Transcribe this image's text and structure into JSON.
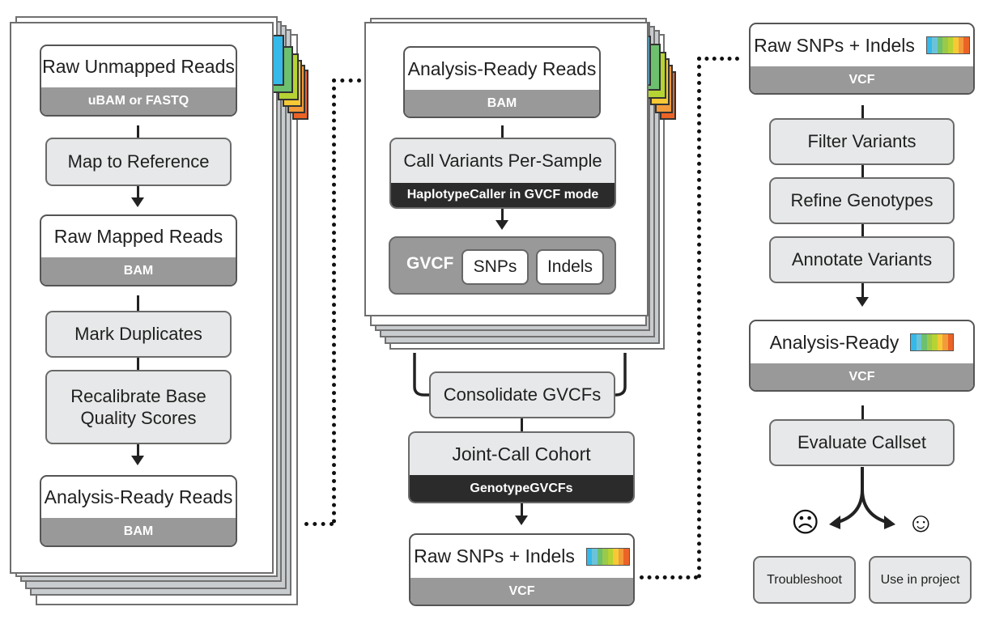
{
  "colors": {
    "tab_blue": "#35b9ea",
    "tab_green": "#6cc06e",
    "tab_lime": "#b6d334",
    "tab_yellow": "#f7c935",
    "tab_orange": "#f39a3b",
    "tab_red": "#ec6326",
    "format_bar": "#999999",
    "tool_bar": "#2b2b2b",
    "step_fill": "#e7e8e9"
  },
  "rainbow": [
    "#35b9ea",
    "#6cc3d8",
    "#6cc06e",
    "#9bc94a",
    "#b6d334",
    "#f7c935",
    "#f39a3b",
    "#ec6326"
  ],
  "panel1": {
    "tab_number": "1",
    "raw_unmapped": {
      "title": "Raw Unmapped Reads",
      "format": "uBAM or FASTQ"
    },
    "map_to_reference": "Map to Reference",
    "raw_mapped": {
      "title": "Raw Mapped Reads",
      "format": "BAM"
    },
    "mark_duplicates": "Mark Duplicates",
    "recalibrate_line1": "Recalibrate Base",
    "recalibrate_line2": "Quality Scores",
    "analysis_ready": {
      "title": "Analysis-Ready Reads",
      "format": "BAM"
    }
  },
  "panel2": {
    "tab_number": "1",
    "analysis_ready": {
      "title": "Analysis-Ready Reads",
      "format": "BAM"
    },
    "call_variants": {
      "title": "Call Variants Per-Sample",
      "tool": "HaplotypeCaller in GVCF mode"
    },
    "gvcf": {
      "label": "GVCF",
      "snps": "SNPs",
      "indels": "Indels"
    },
    "consolidate": "Consolidate GVCFs",
    "joint_call": {
      "title": "Joint-Call Cohort",
      "tool": "GenotypeGVCFs"
    },
    "raw_snps": {
      "title": "Raw SNPs + Indels",
      "format": "VCF"
    }
  },
  "panel3": {
    "raw_snps": {
      "title": "Raw SNPs + Indels",
      "format": "VCF"
    },
    "filter_variants": "Filter Variants",
    "refine_genotypes": "Refine Genotypes",
    "annotate_variants": "Annotate Variants",
    "analysis_ready": {
      "title": "Analysis-Ready",
      "format": "VCF"
    },
    "evaluate_callset": "Evaluate Callset",
    "sad_face": "☹",
    "happy_face": "☺",
    "troubleshoot": "Troubleshoot",
    "use_in_project": "Use in project"
  }
}
